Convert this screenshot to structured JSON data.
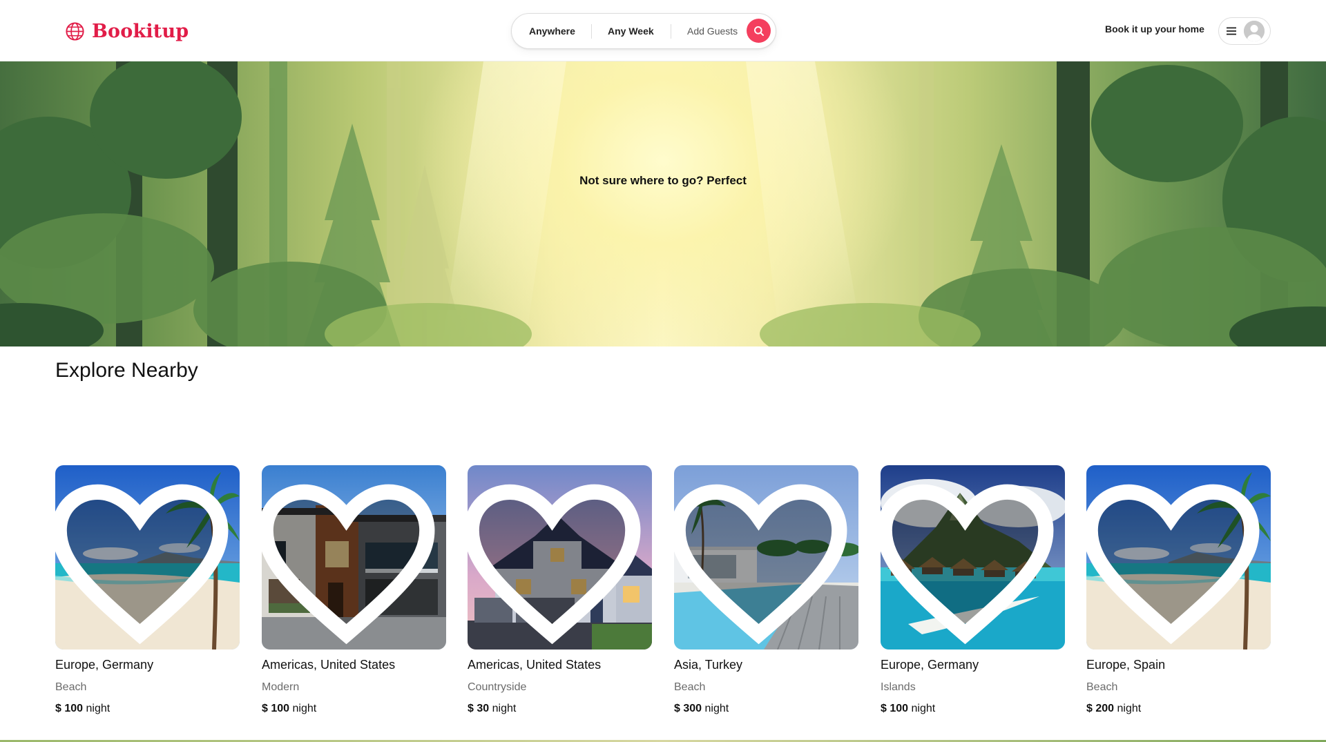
{
  "header": {
    "brand": "Bookitup",
    "search": {
      "anywhere": "Anywhere",
      "any_week": "Any Week",
      "add_guests": "Add Guests"
    },
    "host_link": "Book it up your home"
  },
  "hero": {
    "tagline": "Not sure where to go? Perfect"
  },
  "explore": {
    "title": "Explore Nearby",
    "listings": [
      {
        "location": "Europe, Germany",
        "category": "Beach",
        "currency": "$",
        "price": "100",
        "unit": "night",
        "image": "beach-palm"
      },
      {
        "location": "Americas, United States",
        "category": "Modern",
        "currency": "$",
        "price": "100",
        "unit": "night",
        "image": "modern-house"
      },
      {
        "location": "Americas, United States",
        "category": "Countryside",
        "currency": "$",
        "price": "30",
        "unit": "night",
        "image": "suburban-house-dusk"
      },
      {
        "location": "Asia, Turkey",
        "category": "Beach",
        "currency": "$",
        "price": "300",
        "unit": "night",
        "image": "infinity-pool"
      },
      {
        "location": "Europe, Germany",
        "category": "Islands",
        "currency": "$",
        "price": "100",
        "unit": "night",
        "image": "overwater-bungalows"
      },
      {
        "location": "Europe, Spain",
        "category": "Beach",
        "currency": "$",
        "price": "200",
        "unit": "night",
        "image": "beach-palm"
      }
    ]
  },
  "colors": {
    "brand": "#e11d48",
    "search_button": "#f43f5e",
    "text": "#222222",
    "muted": "#6b6b6b"
  }
}
